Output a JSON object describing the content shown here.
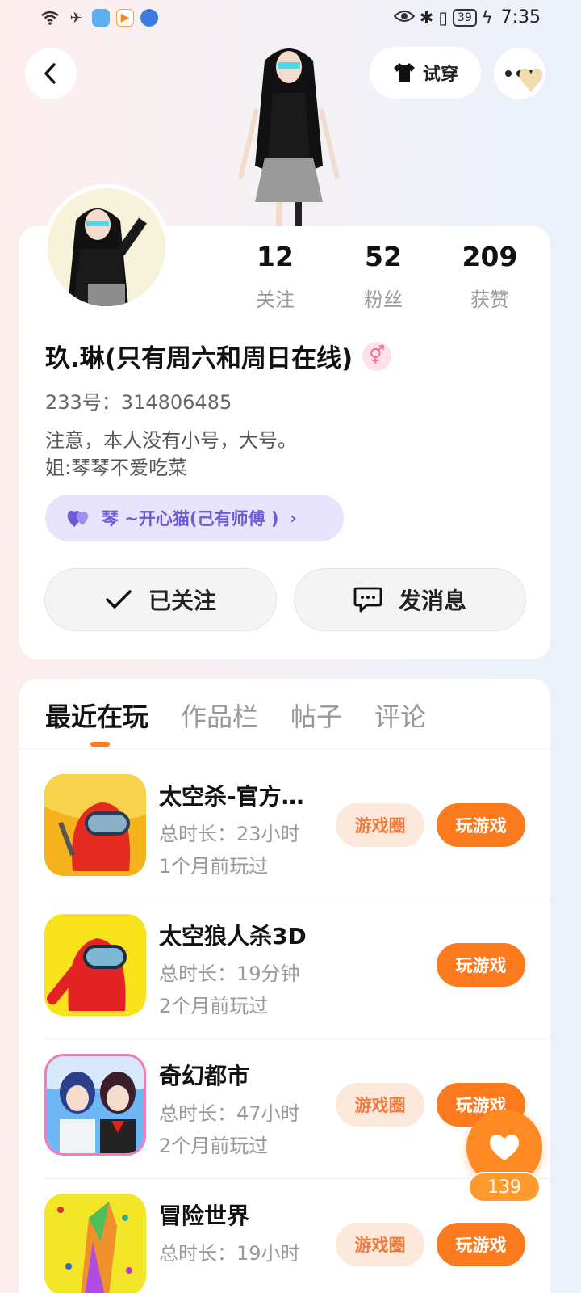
{
  "status_bar": {
    "time": "7:35",
    "battery": "39"
  },
  "header": {
    "tryon_label": "试穿"
  },
  "profile": {
    "stats": [
      {
        "num": "12",
        "label": "关注"
      },
      {
        "num": "52",
        "label": "粉丝"
      },
      {
        "num": "209",
        "label": "获赞"
      }
    ],
    "name": "玖.琳(只有周六和周日在线)",
    "gender_symbol": "⚥",
    "uid": "233号：314806485",
    "bio_line1": "注意，本人没有小号，大号。",
    "bio_line2": "姐:琴琴不爱吃菜",
    "master_tag": "琴 ~开心猫(己有师傅 )",
    "follow_label": "已关注",
    "message_label": "发消息"
  },
  "tabs": [
    "最近在玩",
    "作品栏",
    "帖子",
    "评论"
  ],
  "games": [
    {
      "title": "太空杀-官方正版",
      "time": "总时长：23小时",
      "last": "1个月前玩过",
      "circle": "游戏圈",
      "play": "玩游戏"
    },
    {
      "title": "太空狼人杀3D",
      "time": "总时长：19分钟",
      "last": "2个月前玩过",
      "circle": "",
      "play": "玩游戏"
    },
    {
      "title": "奇幻都市",
      "time": "总时长：47小时",
      "last": "2个月前玩过",
      "circle": "游戏圈",
      "play": "玩游戏"
    },
    {
      "title": "冒险世界",
      "time": "总时长：19小时",
      "last": "",
      "circle": "游戏圈",
      "play": "玩游戏"
    }
  ],
  "like_count": "139"
}
